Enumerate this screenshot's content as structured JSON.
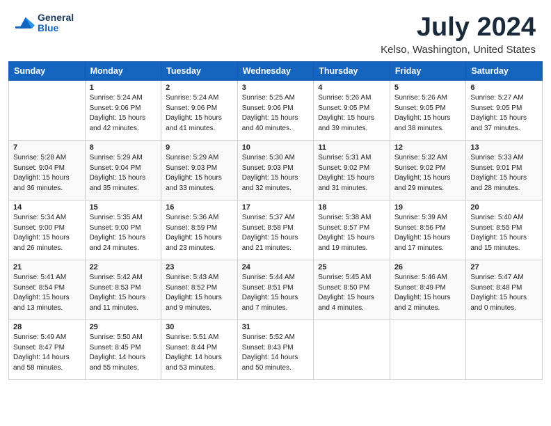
{
  "header": {
    "logo_line1": "General",
    "logo_line2": "Blue",
    "month_title": "July 2024",
    "location": "Kelso, Washington, United States"
  },
  "weekdays": [
    "Sunday",
    "Monday",
    "Tuesday",
    "Wednesday",
    "Thursday",
    "Friday",
    "Saturday"
  ],
  "weeks": [
    [
      {
        "day": "",
        "info": ""
      },
      {
        "day": "1",
        "info": "Sunrise: 5:24 AM\nSunset: 9:06 PM\nDaylight: 15 hours\nand 42 minutes."
      },
      {
        "day": "2",
        "info": "Sunrise: 5:24 AM\nSunset: 9:06 PM\nDaylight: 15 hours\nand 41 minutes."
      },
      {
        "day": "3",
        "info": "Sunrise: 5:25 AM\nSunset: 9:06 PM\nDaylight: 15 hours\nand 40 minutes."
      },
      {
        "day": "4",
        "info": "Sunrise: 5:26 AM\nSunset: 9:05 PM\nDaylight: 15 hours\nand 39 minutes."
      },
      {
        "day": "5",
        "info": "Sunrise: 5:26 AM\nSunset: 9:05 PM\nDaylight: 15 hours\nand 38 minutes."
      },
      {
        "day": "6",
        "info": "Sunrise: 5:27 AM\nSunset: 9:05 PM\nDaylight: 15 hours\nand 37 minutes."
      }
    ],
    [
      {
        "day": "7",
        "info": "Sunrise: 5:28 AM\nSunset: 9:04 PM\nDaylight: 15 hours\nand 36 minutes."
      },
      {
        "day": "8",
        "info": "Sunrise: 5:29 AM\nSunset: 9:04 PM\nDaylight: 15 hours\nand 35 minutes."
      },
      {
        "day": "9",
        "info": "Sunrise: 5:29 AM\nSunset: 9:03 PM\nDaylight: 15 hours\nand 33 minutes."
      },
      {
        "day": "10",
        "info": "Sunrise: 5:30 AM\nSunset: 9:03 PM\nDaylight: 15 hours\nand 32 minutes."
      },
      {
        "day": "11",
        "info": "Sunrise: 5:31 AM\nSunset: 9:02 PM\nDaylight: 15 hours\nand 31 minutes."
      },
      {
        "day": "12",
        "info": "Sunrise: 5:32 AM\nSunset: 9:02 PM\nDaylight: 15 hours\nand 29 minutes."
      },
      {
        "day": "13",
        "info": "Sunrise: 5:33 AM\nSunset: 9:01 PM\nDaylight: 15 hours\nand 28 minutes."
      }
    ],
    [
      {
        "day": "14",
        "info": "Sunrise: 5:34 AM\nSunset: 9:00 PM\nDaylight: 15 hours\nand 26 minutes."
      },
      {
        "day": "15",
        "info": "Sunrise: 5:35 AM\nSunset: 9:00 PM\nDaylight: 15 hours\nand 24 minutes."
      },
      {
        "day": "16",
        "info": "Sunrise: 5:36 AM\nSunset: 8:59 PM\nDaylight: 15 hours\nand 23 minutes."
      },
      {
        "day": "17",
        "info": "Sunrise: 5:37 AM\nSunset: 8:58 PM\nDaylight: 15 hours\nand 21 minutes."
      },
      {
        "day": "18",
        "info": "Sunrise: 5:38 AM\nSunset: 8:57 PM\nDaylight: 15 hours\nand 19 minutes."
      },
      {
        "day": "19",
        "info": "Sunrise: 5:39 AM\nSunset: 8:56 PM\nDaylight: 15 hours\nand 17 minutes."
      },
      {
        "day": "20",
        "info": "Sunrise: 5:40 AM\nSunset: 8:55 PM\nDaylight: 15 hours\nand 15 minutes."
      }
    ],
    [
      {
        "day": "21",
        "info": "Sunrise: 5:41 AM\nSunset: 8:54 PM\nDaylight: 15 hours\nand 13 minutes."
      },
      {
        "day": "22",
        "info": "Sunrise: 5:42 AM\nSunset: 8:53 PM\nDaylight: 15 hours\nand 11 minutes."
      },
      {
        "day": "23",
        "info": "Sunrise: 5:43 AM\nSunset: 8:52 PM\nDaylight: 15 hours\nand 9 minutes."
      },
      {
        "day": "24",
        "info": "Sunrise: 5:44 AM\nSunset: 8:51 PM\nDaylight: 15 hours\nand 7 minutes."
      },
      {
        "day": "25",
        "info": "Sunrise: 5:45 AM\nSunset: 8:50 PM\nDaylight: 15 hours\nand 4 minutes."
      },
      {
        "day": "26",
        "info": "Sunrise: 5:46 AM\nSunset: 8:49 PM\nDaylight: 15 hours\nand 2 minutes."
      },
      {
        "day": "27",
        "info": "Sunrise: 5:47 AM\nSunset: 8:48 PM\nDaylight: 15 hours\nand 0 minutes."
      }
    ],
    [
      {
        "day": "28",
        "info": "Sunrise: 5:49 AM\nSunset: 8:47 PM\nDaylight: 14 hours\nand 58 minutes."
      },
      {
        "day": "29",
        "info": "Sunrise: 5:50 AM\nSunset: 8:45 PM\nDaylight: 14 hours\nand 55 minutes."
      },
      {
        "day": "30",
        "info": "Sunrise: 5:51 AM\nSunset: 8:44 PM\nDaylight: 14 hours\nand 53 minutes."
      },
      {
        "day": "31",
        "info": "Sunrise: 5:52 AM\nSunset: 8:43 PM\nDaylight: 14 hours\nand 50 minutes."
      },
      {
        "day": "",
        "info": ""
      },
      {
        "day": "",
        "info": ""
      },
      {
        "day": "",
        "info": ""
      }
    ]
  ]
}
